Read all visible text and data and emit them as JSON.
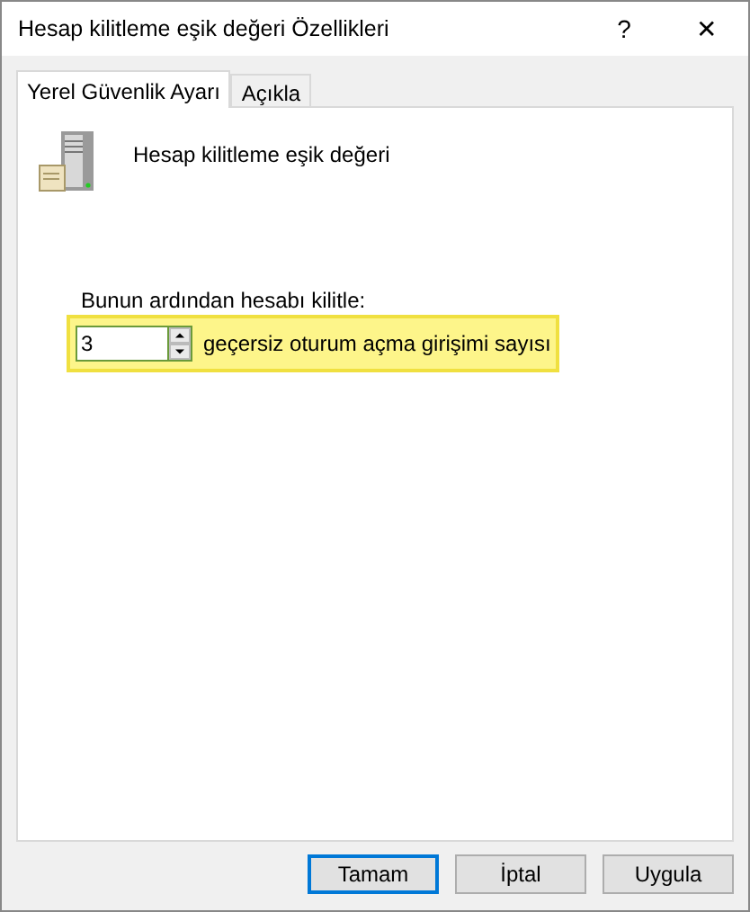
{
  "window": {
    "title": "Hesap kilitleme eşik değeri Özellikleri",
    "help": "?",
    "close": "✕"
  },
  "tabs": [
    {
      "label": "Yerel Güvenlik Ayarı",
      "selected": true
    },
    {
      "label": "Açıkla",
      "selected": false
    }
  ],
  "policy": {
    "name": "Hesap kilitleme eşik değeri"
  },
  "setting": {
    "label": "Bunun ardından hesabı kilitle:",
    "value": "3",
    "unit": "geçersiz oturum açma girişimi sayısı",
    "highlighted": true
  },
  "buttons": [
    {
      "label": "Tamam",
      "default": true
    },
    {
      "label": "İptal",
      "default": false
    },
    {
      "label": "Uygula",
      "default": false
    }
  ]
}
